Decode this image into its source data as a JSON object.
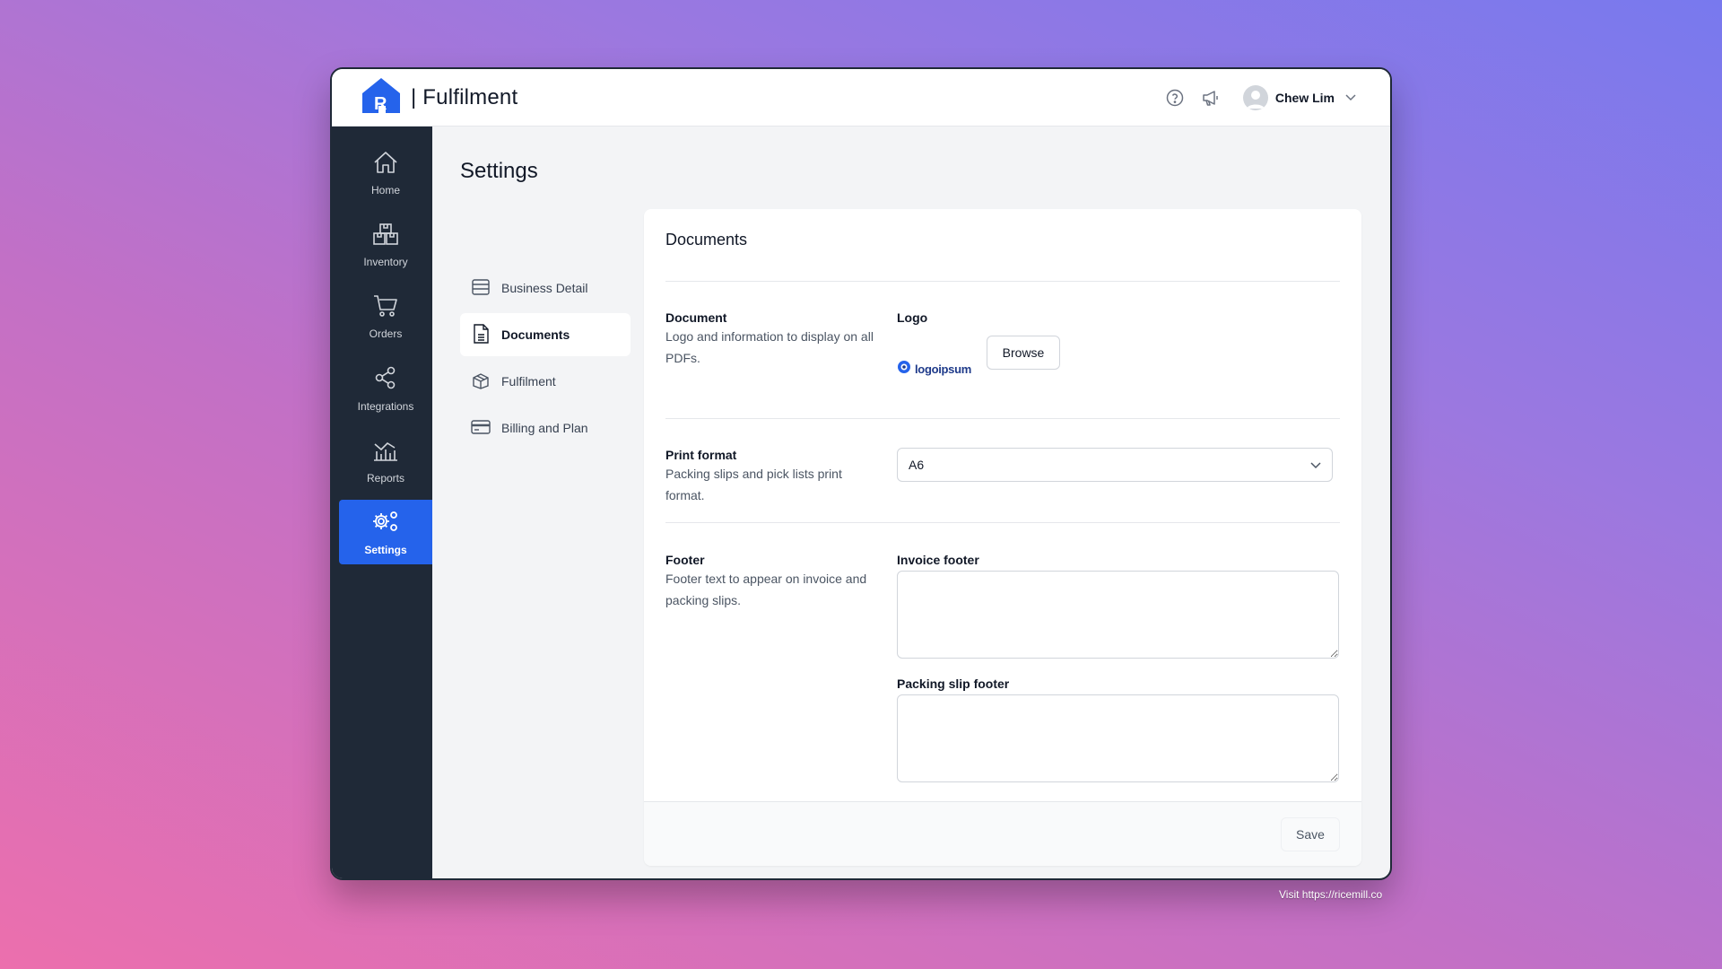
{
  "app": {
    "title": "| Fulfilment"
  },
  "header": {
    "help_icon": "help-circle-icon",
    "announce_icon": "megaphone-icon",
    "user_name": "Chew Lim"
  },
  "sidebar": {
    "items": [
      {
        "label": "Home",
        "icon": "home-icon"
      },
      {
        "label": "Inventory",
        "icon": "inventory-icon"
      },
      {
        "label": "Orders",
        "icon": "cart-icon"
      },
      {
        "label": "Integrations",
        "icon": "share-icon"
      },
      {
        "label": "Reports",
        "icon": "chart-icon"
      },
      {
        "label": "Settings",
        "icon": "gears-icon",
        "active": true
      }
    ]
  },
  "page": {
    "title": "Settings"
  },
  "settings_nav": {
    "items": [
      {
        "label": "Business Detail",
        "icon": "store-icon"
      },
      {
        "label": "Documents",
        "icon": "document-icon",
        "active": true
      },
      {
        "label": "Fulfilment",
        "icon": "box-icon"
      },
      {
        "label": "Billing and Plan",
        "icon": "credit-card-icon"
      }
    ]
  },
  "documents": {
    "title": "Documents",
    "document_section": {
      "title": "Document",
      "description": "Logo and information to display on all PDFs.",
      "logo_label": "Logo",
      "logo_text": "logoipsum",
      "browse_label": "Browse"
    },
    "print_section": {
      "title": "Print format",
      "description": "Packing slips and pick lists print format.",
      "selected_value": "A6"
    },
    "footer_section": {
      "title": "Footer",
      "description": "Footer text to appear on invoice and packing slips.",
      "invoice_footer_label": "Invoice footer",
      "invoice_footer_value": "",
      "packing_footer_label": "Packing slip footer",
      "packing_footer_value": ""
    },
    "save_label": "Save"
  },
  "watermark": {
    "text": "Visit https://ricemill.co"
  },
  "colors": {
    "accent": "#2563eb",
    "sidebar_bg": "#1f2937",
    "content_bg": "#f3f4f6"
  }
}
